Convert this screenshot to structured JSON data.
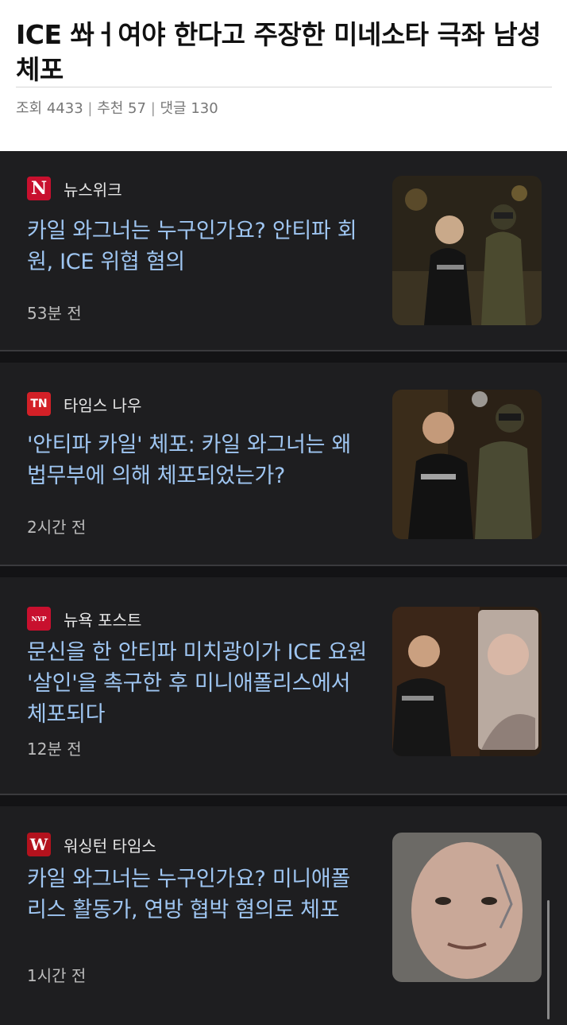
{
  "post": {
    "title": "ICE 쏴ㅓ여야 한다고 주장한 미네소타 극좌 남성 체포",
    "meta": {
      "views": "조회 4433",
      "likes": "추천 57",
      "comments": "댓글 130",
      "separator": "|"
    }
  },
  "articles": [
    {
      "source": "뉴스위크",
      "logo_text": "N",
      "logo_color": "#c8102e",
      "headline": "카일 와그너는 누구인가요? 안티파 회원, ICE 위협 혐의",
      "time": "53분 전"
    },
    {
      "source": "타임스 나우",
      "logo_text": "TN",
      "logo_color": "#d32027",
      "headline": "'안티파 카일' 체포: 카일 와그너는 왜 법무부에 의해 체포되었는가?",
      "time": "2시간 전"
    },
    {
      "source": "뉴욕 포스트",
      "logo_text": "NYP",
      "logo_color": "#c8102e",
      "headline": "문신을 한 안티파 미치광이가 ICE 요원 '살인'을 촉구한 후 미니애폴리스에서 체포되다",
      "time": "12분 전"
    },
    {
      "source": "워싱턴 타임스",
      "logo_text": "W",
      "logo_color": "#b3121d",
      "headline": "카일 와그너는 누구인가요? 미니애폴리스 활동가, 연방 협박 혐의로 체포",
      "time": "1시간 전"
    }
  ],
  "colors": {
    "feed_background": "#1e1e20",
    "headline": "#9fc6f2",
    "source_text": "#e6e6e6",
    "time_text": "#bdbdbd"
  }
}
